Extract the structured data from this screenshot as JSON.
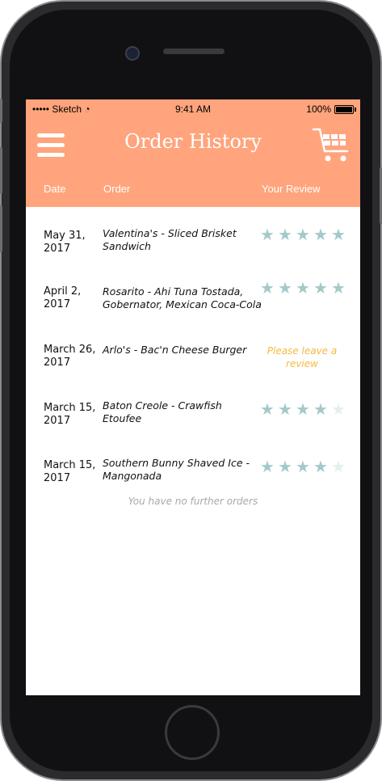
{
  "status_bar": {
    "carrier": "••••• Sketch",
    "time": "9:41 AM",
    "battery": "100%"
  },
  "header": {
    "title": "Order History",
    "menu_icon": "hamburger-menu-icon",
    "cart_icon": "shopping-cart-icon"
  },
  "columns": {
    "date": "Date",
    "order": "Order",
    "review": "Your Review"
  },
  "orders": [
    {
      "date_line1": "May 31,",
      "date_line2": "2017",
      "order_line1": "Valentina's - Sliced Brisket",
      "order_line2": "Sandwich",
      "rating": 5
    },
    {
      "date_line1": "April 2,",
      "date_line2": "2017",
      "order_line1": "Rosarito - Ahi Tuna Tostada,",
      "order_line2": "Gobernator, Mexican Coca-Cola",
      "rating": 5
    },
    {
      "date_line1": "March 26,",
      "date_line2": "2017",
      "order_line1": "Arlo's - Bac'n Cheese Burger",
      "order_line2": "",
      "review_prompt_line1": "Please leave a",
      "review_prompt_line2": "review"
    },
    {
      "date_line1": "March 15,",
      "date_line2": "2017",
      "order_line1": "Baton Creole - Crawfish",
      "order_line2": "Etoufee",
      "rating": 4
    },
    {
      "date_line1": "March 15,",
      "date_line2": "2017",
      "order_line1": "Southern Bunny Shaved Ice -",
      "order_line2": "Mangonada",
      "rating": 4
    }
  ],
  "footer_note": "You have no further orders",
  "colors": {
    "header": "#ffa47c",
    "star": "#a4c9c9",
    "star_empty": "#e4f0f0",
    "prompt": "#f5b942"
  }
}
